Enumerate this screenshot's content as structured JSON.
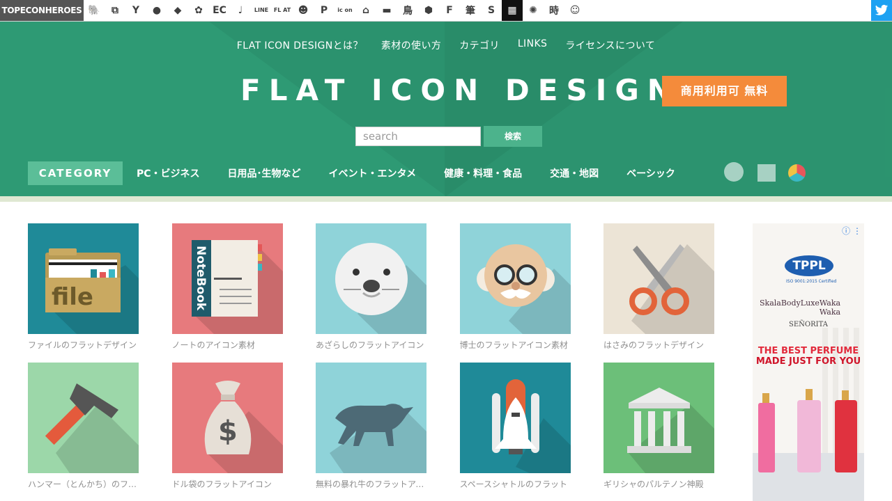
{
  "topbar": {
    "brand": "TOPECONHEROES",
    "site_icons": [
      {
        "name": "animal-icon",
        "glyph": "🐘",
        "dark": false
      },
      {
        "name": "copy-icon",
        "glyph": "⧉",
        "dark": false
      },
      {
        "name": "person-icon",
        "glyph": "Y",
        "dark": false
      },
      {
        "name": "speech-bubble-icon",
        "glyph": "●",
        "dark": false
      },
      {
        "name": "tag-icon",
        "glyph": "◆",
        "dark": false
      },
      {
        "name": "flower-icon",
        "glyph": "✿",
        "dark": false
      },
      {
        "name": "ec-icon",
        "text": "EC",
        "dark": false
      },
      {
        "name": "music-note-icon",
        "glyph": "♩",
        "dark": false
      },
      {
        "name": "line-icon",
        "text": "LINE",
        "dark": false
      },
      {
        "name": "flat-icon",
        "text": "FL AT",
        "dark": false
      },
      {
        "name": "smiley-icon",
        "glyph": "☻",
        "dark": false
      },
      {
        "name": "parking-icon",
        "text": "P",
        "dark": false
      },
      {
        "name": "icon-text-icon",
        "text": "ic on",
        "dark": false
      },
      {
        "name": "building-icon",
        "glyph": "⌂",
        "dark": false
      },
      {
        "name": "sofa-icon",
        "glyph": "▬",
        "dark": false
      },
      {
        "name": "bird-kanji-icon",
        "text": "鳥",
        "dark": false
      },
      {
        "name": "hexagon-icon",
        "glyph": "⬢",
        "dark": false
      },
      {
        "name": "font-f-icon",
        "text": "F",
        "dark": false
      },
      {
        "name": "brush-kanji-icon",
        "text": "筆",
        "dark": false
      },
      {
        "name": "s-icon",
        "text": "S",
        "dark": false
      },
      {
        "name": "grid-icon",
        "glyph": "▦",
        "dark": true
      },
      {
        "name": "burst-icon",
        "glyph": "✺",
        "dark": false
      },
      {
        "name": "time-kanji-icon",
        "text": "時",
        "dark": false
      },
      {
        "name": "girl-face-icon",
        "glyph": "☺",
        "dark": false
      }
    ]
  },
  "nav": [
    "FLAT ICON DESIGNとは？",
    "素材の使い方",
    "カテゴリ",
    "LINKS",
    "ライセンスについて"
  ],
  "logo": "FLAT ICON DESIGN",
  "badge": "商用利用可 無料",
  "search": {
    "placeholder": "search",
    "button": "検索"
  },
  "category": {
    "label": "CATEGORY",
    "items": [
      "PC・ビジネス",
      "日用品･生物など",
      "イベント・エンタメ",
      "健康・料理・食品",
      "交通・地図",
      "ベーシック"
    ]
  },
  "cards": [
    {
      "caption": "ファイルのフラットデザイン",
      "bg": "#1f8a98",
      "art": "file",
      "art_text": "file"
    },
    {
      "caption": "ノートのアイコン素材",
      "bg": "#e77a7d",
      "art": "notebook",
      "art_text": "NoteBook"
    },
    {
      "caption": "あざらしのフラットアイコン",
      "bg": "#8fd3d9",
      "art": "seal"
    },
    {
      "caption": "博士のフラットアイコン素材",
      "bg": "#8fd3d9",
      "art": "professor"
    },
    {
      "caption": "はさみのフラットデザイン",
      "bg": "#ece4d6",
      "art": "scissors"
    },
    {
      "caption": "ハンマー（とんかち）のフラット",
      "bg": "#9cd7a9",
      "art": "hammer"
    },
    {
      "caption": "ドル袋のフラットアイコン",
      "bg": "#e77a7d",
      "art": "moneybag",
      "art_text": "$"
    },
    {
      "caption": "無料の暴れ牛のフラットアイコン",
      "bg": "#8fd3d9",
      "art": "bull"
    },
    {
      "caption": "スペースシャトルのフラット",
      "bg": "#1f8a98",
      "art": "shuttle"
    },
    {
      "caption": "ギリシャのパルテノン神殿",
      "bg": "#6cbf79",
      "art": "temple"
    }
  ],
  "ad": {
    "info": "ⓘ ⋮",
    "logo": "TPPL",
    "iso": "ISO 9001:2015 Certified",
    "brands": [
      "Skala",
      "BodyLuxe",
      "Waka Waka"
    ],
    "senorita": "SEÑORITA",
    "headline1": "THE BEST PERFUME",
    "headline2": "MADE JUST FOR YOU"
  },
  "colors": {
    "header": "#2e9a74",
    "accent": "#4cb38c",
    "badge": "#f48b3b",
    "twitter": "#1da1f2"
  }
}
